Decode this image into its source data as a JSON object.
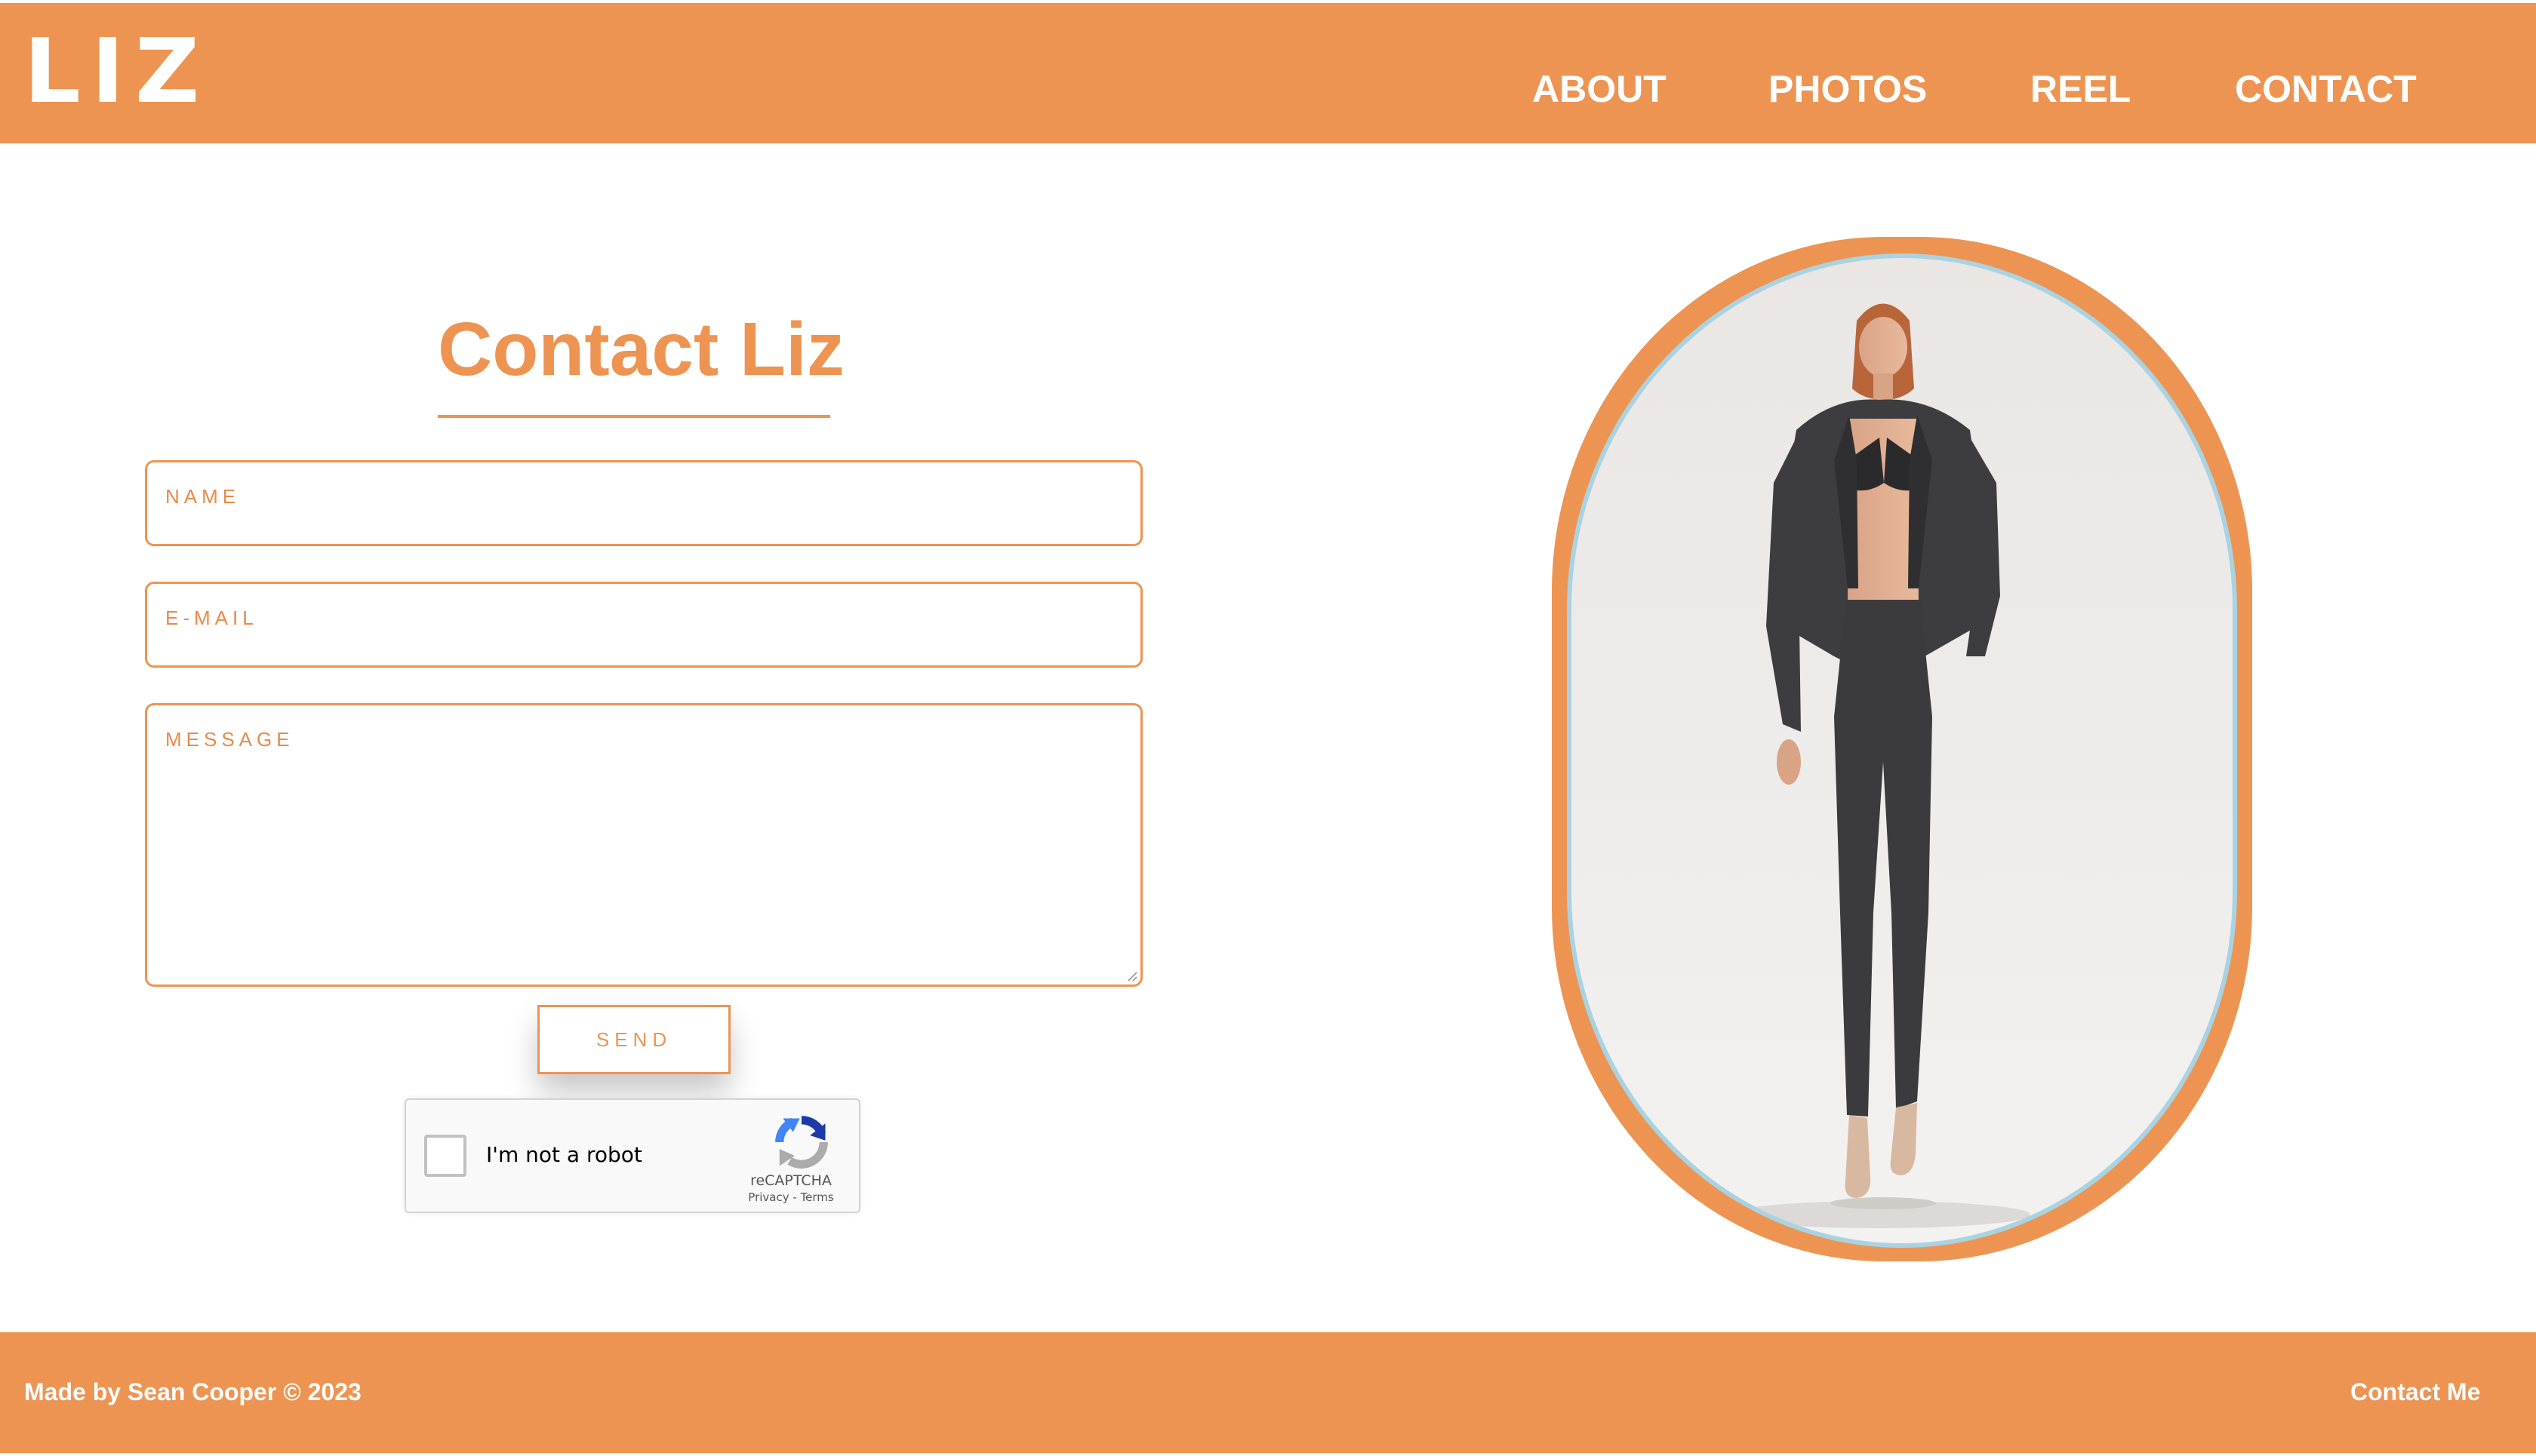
{
  "header": {
    "logo": "LIZ",
    "nav": [
      {
        "label": "ABOUT"
      },
      {
        "label": "PHOTOS"
      },
      {
        "label": "REEL"
      },
      {
        "label": "CONTACT"
      }
    ]
  },
  "contact_form": {
    "title": "Contact Liz",
    "fields": {
      "name": {
        "placeholder": "NAME",
        "value": ""
      },
      "email": {
        "placeholder": "E-MAIL",
        "value": ""
      },
      "message": {
        "placeholder": "MESSAGE",
        "value": ""
      }
    },
    "send_label": "SEND"
  },
  "recaptcha": {
    "label": "I'm not a robot",
    "brand": "reCAPTCHA",
    "links": "Privacy - Terms",
    "checked": false
  },
  "portrait": {
    "subject": "model-in-charcoal-suit",
    "frame_color": "#EE9452",
    "outline_color": "#A9D3E2"
  },
  "footer": {
    "credit": "Made by Sean Cooper © 2023",
    "contact_link": "Contact Me"
  },
  "colors": {
    "accent": "#EE9452",
    "background": "#FFFFFF",
    "text_light": "#FFFFFF"
  }
}
